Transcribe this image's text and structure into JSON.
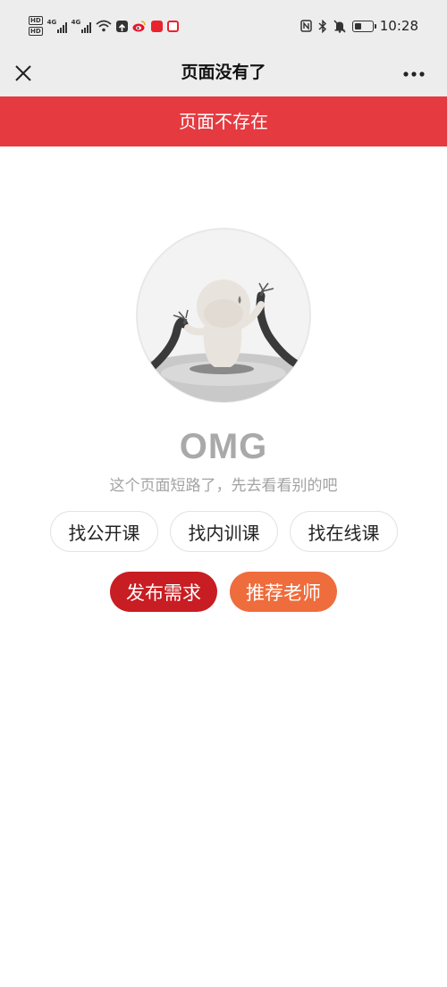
{
  "status_bar": {
    "time": "10:28",
    "hd_labels": [
      "HD",
      "HD"
    ],
    "network_labels": [
      "4G",
      "4G"
    ],
    "app_icons": [
      "upload-icon",
      "weibo-icon",
      "news-app-icon",
      "notes-app-icon"
    ],
    "right_icons": [
      "nfc-icon",
      "bluetooth-icon",
      "mute-icon",
      "battery-icon"
    ],
    "battery_level": 0.35
  },
  "nav": {
    "title": "页面没有了",
    "close_icon": "close-icon",
    "more_icon": "more-icon"
  },
  "header": {
    "title": "页面不存在",
    "color": "#e53a40"
  },
  "main": {
    "illustration": "broken-cable-figure",
    "heading": "OMG",
    "subtitle": "这个页面短路了，先去看看别的吧",
    "links": [
      {
        "label": "找公开课"
      },
      {
        "label": "找内训课"
      },
      {
        "label": "找在线课"
      }
    ],
    "actions": [
      {
        "label": "发布需求",
        "color": "#c81d22"
      },
      {
        "label": "推荐老师",
        "color": "#ef6c3c"
      }
    ]
  }
}
